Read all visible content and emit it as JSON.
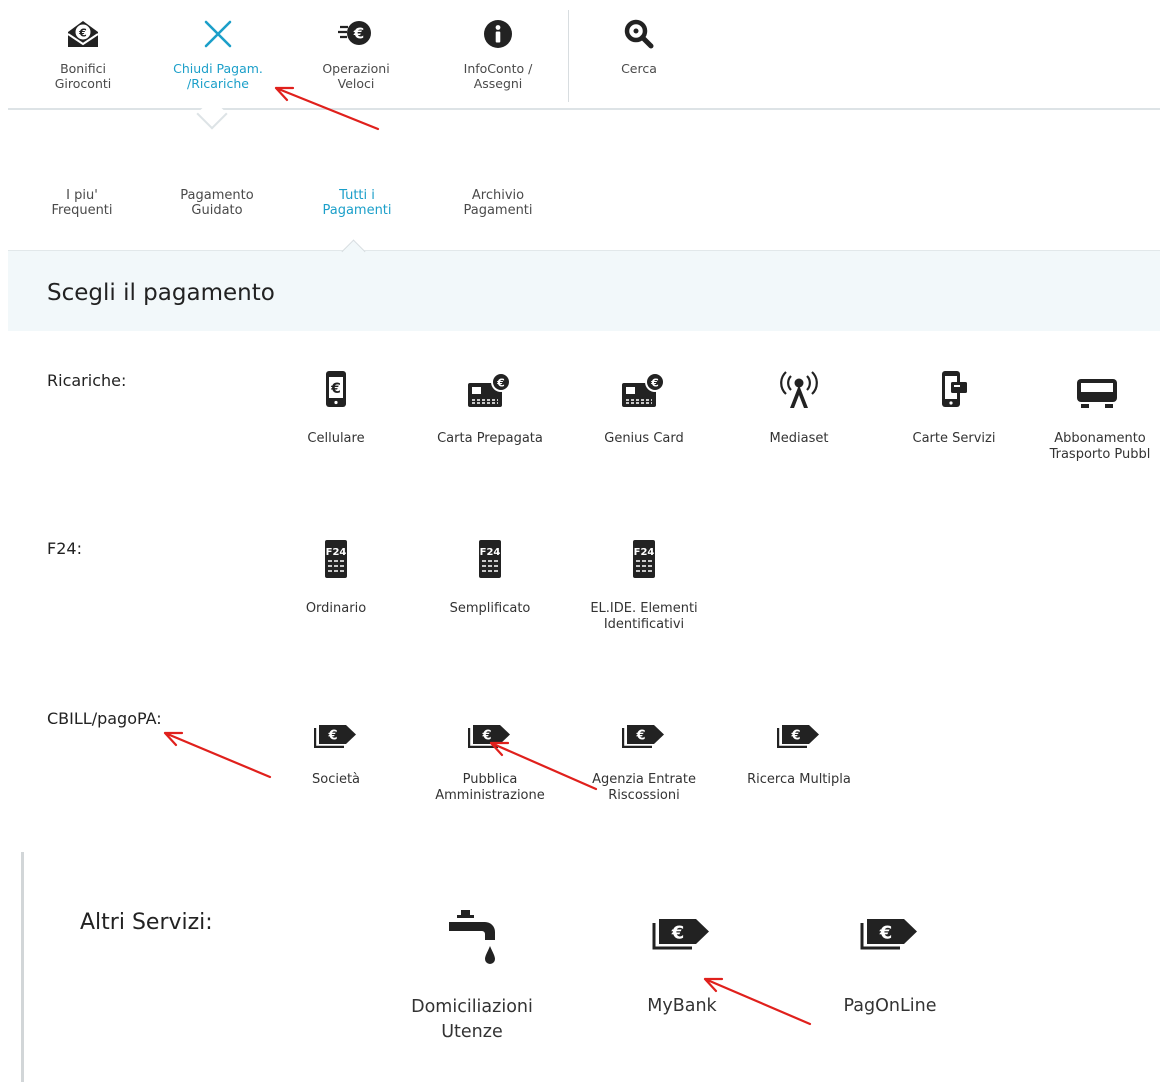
{
  "topnav": {
    "items": [
      {
        "label": "Bonifici\nGiroconti",
        "icon": "envelope-euro-icon"
      },
      {
        "label": "Chiudi Pagam.\n/Ricariche",
        "icon": "close-icon",
        "active": true
      },
      {
        "label": "Operazioni\nVeloci",
        "icon": "fast-euro-icon"
      },
      {
        "label": "InfoConto /\nAssegni",
        "icon": "info-icon"
      },
      {
        "label": "Cerca",
        "icon": "search-icon"
      }
    ]
  },
  "subtabs": {
    "items": [
      {
        "label": "I piu'\nFrequenti"
      },
      {
        "label": "Pagamento\nGuidato"
      },
      {
        "label": "Tutti i\nPagamenti",
        "active": true
      },
      {
        "label": "Archivio\nPagamenti"
      }
    ]
  },
  "header": {
    "title": "Scegli il pagamento"
  },
  "ricariche": {
    "label": "Ricariche:",
    "items": [
      {
        "label": "Cellulare",
        "icon": "mobile-euro-icon"
      },
      {
        "label": "Carta Prepagata",
        "icon": "card-euro-icon"
      },
      {
        "label": "Genius Card",
        "icon": "card-euro-icon"
      },
      {
        "label": "Mediaset",
        "icon": "antenna-icon"
      },
      {
        "label": "Carte Servizi",
        "icon": "phone-card-icon"
      },
      {
        "label": "Abbonamento\nTrasporto Pubbl",
        "icon": "bus-icon"
      }
    ]
  },
  "f24": {
    "label": "F24:",
    "items": [
      {
        "label": "Ordinario",
        "icon": "f24-icon"
      },
      {
        "label": "Semplificato",
        "icon": "f24-icon"
      },
      {
        "label": "EL.IDE. Elementi\nIdentificativi",
        "icon": "f24-icon"
      }
    ],
    "icon_text": "F24"
  },
  "cbill": {
    "label": "CBILL/pagoPA:",
    "items": [
      {
        "label": "Società",
        "icon": "euro-tag-icon"
      },
      {
        "label": "Pubblica\nAmministrazione",
        "icon": "euro-tag-icon"
      },
      {
        "label": "Agenzia Entrate\nRiscossioni",
        "icon": "euro-tag-icon"
      },
      {
        "label": "Ricerca Multipla",
        "icon": "euro-tag-icon"
      }
    ]
  },
  "altri": {
    "label": "Altri Servizi:",
    "items": [
      {
        "label": "Domiciliazioni\nUtenze",
        "icon": "faucet-icon"
      },
      {
        "label": "MyBank",
        "icon": "euro-tag-icon"
      },
      {
        "label": "PagOnLine",
        "icon": "euro-tag-icon"
      }
    ]
  },
  "colors": {
    "accent": "#1b9fc9",
    "icon": "#222222",
    "annotation_arrow": "#e0201c",
    "band": "#f2f8fa"
  }
}
